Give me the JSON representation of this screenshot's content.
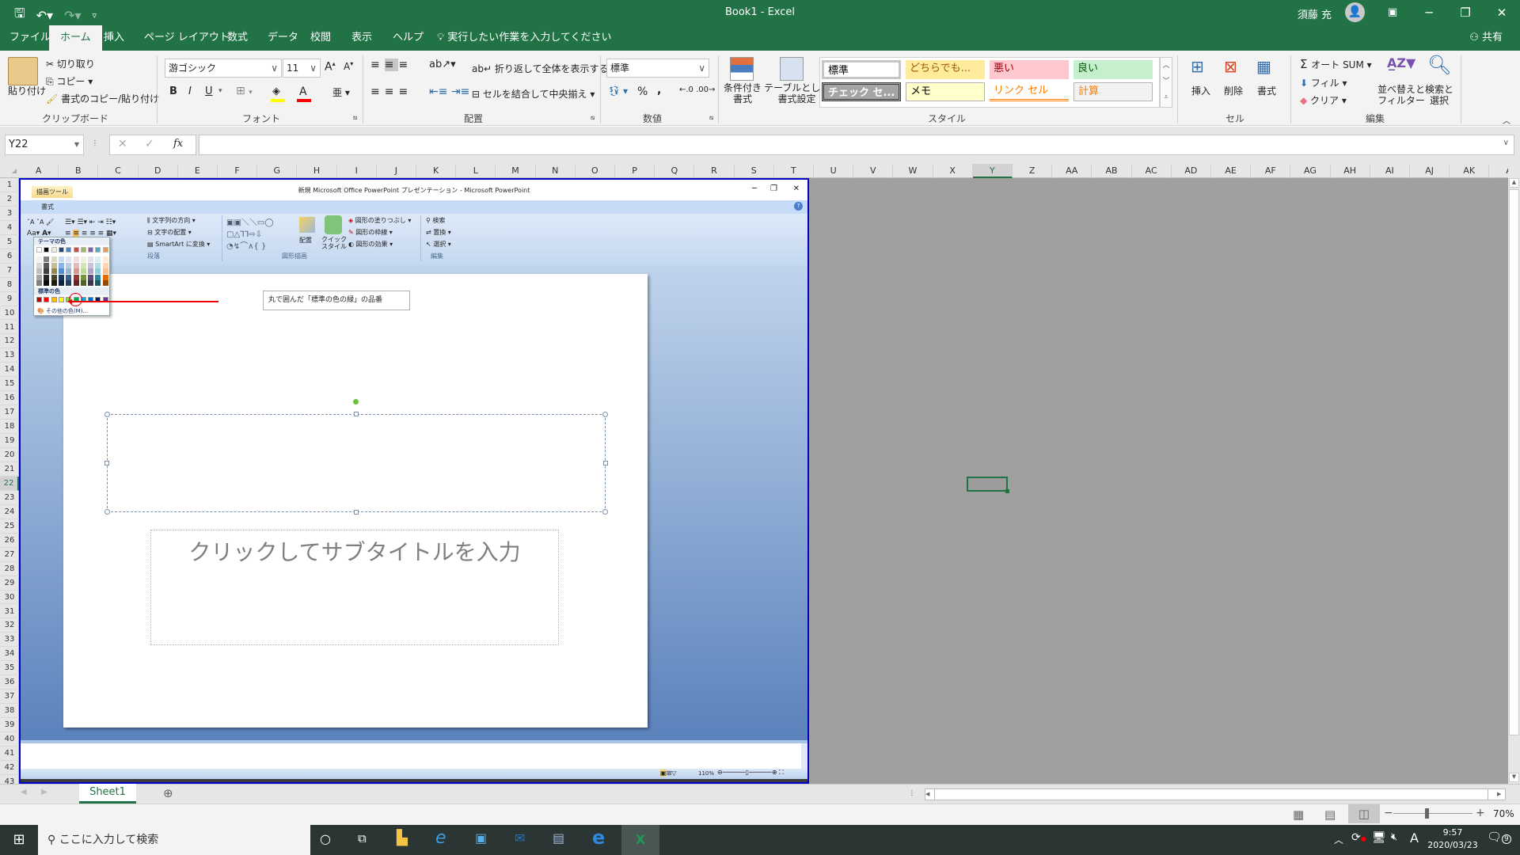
{
  "window": {
    "title": "Book1  -  Excel",
    "user_name": "須藤 充",
    "quick_access": [
      "save-icon",
      "undo-icon",
      "redo-icon",
      "customize-icon"
    ],
    "controls": {
      "ribbon_display": "▣",
      "minimize": "─",
      "restore": "❐",
      "close": "✕"
    }
  },
  "tabs": {
    "items": [
      "ファイル",
      "ホーム",
      "挿入",
      "ページ レイアウト",
      "数式",
      "データ",
      "校閲",
      "表示",
      "ヘルプ"
    ],
    "active": "ホーム",
    "tell_me": "実行したい作業を入力してください",
    "share": "共有"
  },
  "ribbon": {
    "clipboard": {
      "paste": "貼り付け",
      "cut": "切り取り",
      "copy": "コピー",
      "format_painter": "書式のコピー/貼り付け",
      "label": "クリップボード"
    },
    "font": {
      "name": "游ゴシック",
      "size": "11",
      "bold": "B",
      "italic": "I",
      "underline": "U",
      "label": "フォント",
      "fill_color": "#ffff00",
      "font_color": "#ff0000"
    },
    "alignment": {
      "wrap_text": "折り返して全体を表示する",
      "merge_center": "セルを結合して中央揃え",
      "label": "配置"
    },
    "number": {
      "format": "標準",
      "percent": "%",
      "comma": ",",
      "label": "数値"
    },
    "styles": {
      "conditional": "条件付き\n書式",
      "conditional_line1": "条件付き",
      "conditional_line2": "書式",
      "table_line1": "テーブルとして",
      "table_line2": "書式設定",
      "cells": [
        {
          "label": "標準",
          "bg": "#ffffff",
          "fg": "#000000"
        },
        {
          "label": "どちらでも...",
          "bg": "#ffeb9c",
          "fg": "#9c5700"
        },
        {
          "label": "悪い",
          "bg": "#ffc7ce",
          "fg": "#9c0006"
        },
        {
          "label": "良い",
          "bg": "#c6efce",
          "fg": "#006100"
        },
        {
          "label": "チェック セ...",
          "bg": "#a5a5a5",
          "fg": "#ffffff"
        },
        {
          "label": "メモ",
          "bg": "#ffffcc",
          "fg": "#000000"
        },
        {
          "label": "リンク セル",
          "bg": "#ffffff",
          "fg": "#fa7d00"
        },
        {
          "label": "計算",
          "bg": "#f2f2f2",
          "fg": "#fa7d00"
        }
      ],
      "label": "スタイル"
    },
    "cells": {
      "insert": "挿入",
      "delete": "削除",
      "format": "書式",
      "label": "セル"
    },
    "editing": {
      "autosum": "オート SUM",
      "fill": "フィル",
      "clear": "クリア",
      "sort_line1": "並べ替えと",
      "sort_line2": "フィルター",
      "find_line1": "検索と",
      "find_line2": "選択",
      "label": "編集"
    }
  },
  "formula_bar": {
    "name_box": "Y22",
    "cancel": "✕",
    "enter": "✓",
    "fx": "fx",
    "value": ""
  },
  "grid": {
    "columns": [
      "A",
      "B",
      "C",
      "D",
      "E",
      "F",
      "G",
      "H",
      "I",
      "J",
      "K",
      "L",
      "M",
      "N",
      "O",
      "P",
      "Q",
      "R",
      "S",
      "T",
      "U",
      "V",
      "W",
      "X",
      "Y",
      "Z",
      "AA",
      "AB",
      "AC",
      "AD",
      "AE",
      "AF",
      "AG",
      "AH",
      "AI",
      "AJ",
      "AK",
      "A"
    ],
    "selected_column": "Y",
    "rows": [
      "1",
      "2",
      "3",
      "4",
      "5",
      "6",
      "7",
      "8",
      "9",
      "10",
      "11",
      "12",
      "13",
      "14",
      "15",
      "16",
      "17",
      "18",
      "19",
      "20",
      "21",
      "22",
      "23",
      "24",
      "25",
      "26",
      "27",
      "28",
      "29",
      "30",
      "31",
      "32",
      "33",
      "34",
      "35",
      "36",
      "37",
      "38",
      "39",
      "40",
      "41",
      "42",
      "43"
    ],
    "selected_row": "22"
  },
  "embedded_ppt": {
    "title": "新規 Microsoft Office PowerPoint プレゼンテーション - Microsoft PowerPoint",
    "context_tab": "描画ツール",
    "context_subtab": "書式",
    "ribbon_items": {
      "text_direction": "文字列の方向",
      "text_align": "文字の配置",
      "smartart": "SmartArt に変換",
      "arrange": "配置",
      "quick_styles": "クイック\nスタイル",
      "quick_styles_line1": "クイック",
      "quick_styles_line2": "スタイル",
      "shape_fill": "図形の塗りつぶし",
      "shape_outline": "図形の枠線",
      "shape_effects": "図形の効果",
      "find": "検索",
      "replace": "置換",
      "select": "選択",
      "group_drawing": "図形描画",
      "group_editing": "編集",
      "group_paragraph": "段落"
    },
    "color_picker": {
      "theme_label": "テーマの色",
      "theme_top": [
        "#ffffff",
        "#000000",
        "#eeece1",
        "#1f497d",
        "#4f81bd",
        "#c0504d",
        "#9bbb59",
        "#8064a2",
        "#4bacc6",
        "#f79646"
      ],
      "theme_shades": [
        [
          "#f2f2f2",
          "#d8d8d8",
          "#bfbfbf",
          "#a5a5a5",
          "#7f7f7f"
        ],
        [
          "#7f7f7f",
          "#595959",
          "#3f3f3f",
          "#262626",
          "#0c0c0c"
        ],
        [
          "#ddd9c3",
          "#c4bd97",
          "#938953",
          "#494429",
          "#1d1b10"
        ],
        [
          "#c6d9f0",
          "#8db3e2",
          "#548dd4",
          "#17365d",
          "#0f243e"
        ],
        [
          "#dbe5f1",
          "#b8cce4",
          "#95b3d7",
          "#366092",
          "#244061"
        ],
        [
          "#f2dcdb",
          "#e5b9b7",
          "#d99694",
          "#953734",
          "#632423"
        ],
        [
          "#ebf1dd",
          "#d7e3bc",
          "#c3d69b",
          "#76923c",
          "#4f6128"
        ],
        [
          "#e5e0ec",
          "#ccc1d9",
          "#b2a2c7",
          "#5f497a",
          "#3f3151"
        ],
        [
          "#dbeef3",
          "#b7dde8",
          "#92cddc",
          "#31859b",
          "#205867"
        ],
        [
          "#fdeada",
          "#fbd5b5",
          "#fac08f",
          "#e36c09",
          "#974806"
        ]
      ],
      "standard_label": "標準の色",
      "standard": [
        "#c00000",
        "#ff0000",
        "#ffc000",
        "#ffff00",
        "#92d050",
        "#00b050",
        "#00b0f0",
        "#0070c0",
        "#002060",
        "#7030a0"
      ],
      "circled_color": "#00b050",
      "more_colors": "その他の色(M)..."
    },
    "callout": "丸で囲んだ「標準の色の緑」の品番",
    "subtitle_placeholder": "クリックしてサブタイトルを入力",
    "zoom": "110%"
  },
  "sheet_tabs": {
    "sheets": [
      "Sheet1"
    ],
    "active": "Sheet1",
    "add": "⊕"
  },
  "status_bar": {
    "zoom": "70%",
    "zoom_fraction": 0.42
  },
  "taskbar": {
    "search_placeholder": "ここに入力して検索",
    "time": "9:57",
    "date": "2020/03/23",
    "notifications": "9",
    "ime": "A"
  }
}
